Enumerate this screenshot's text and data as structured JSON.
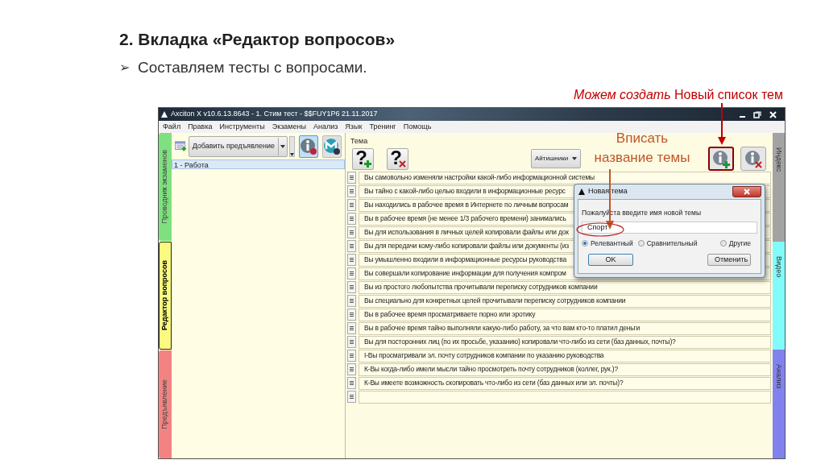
{
  "slide": {
    "heading": "2. Вкладка «Редактор вопросов»",
    "bullet": {
      "marker": "➢",
      "text": "Составляем тесты с вопросами."
    }
  },
  "callouts": [
    {
      "kind": "top",
      "text": "*Можем создать* Новый список тем"
    },
    {
      "kind": "field",
      "text": "Вписать название темы"
    }
  ],
  "window": {
    "title": "Axciton X v10.6.13.8643 - 1. Стим тест - $$FUY1P6 21.11.2017",
    "menu": [
      "Файл",
      "Правка",
      "Инструменты",
      "Экзамены",
      "Анализ",
      "Язык",
      "Тренинг",
      "Помощь"
    ],
    "left_tabs": [
      {
        "label": "Проводник экзаменов",
        "color": "#7fe07f",
        "selected": false
      },
      {
        "label": "Редактор вопросов",
        "color": "#fafa80",
        "selected": true
      },
      {
        "label": "Предъявление",
        "color": "#f38383",
        "selected": false
      }
    ],
    "toolbar": {
      "add_button": "Добавить предъявление",
      "tools": [
        {
          "kind": "info",
          "selected": true
        },
        {
          "kind": "media",
          "selected": false
        }
      ]
    },
    "exams": [
      {
        "label": "1 - Работа",
        "selected": true
      }
    ],
    "topic_label": "Тема",
    "question_buttons": [
      {
        "kind": "add",
        "symbol": "?"
      },
      {
        "kind": "delete",
        "symbol": "?"
      }
    ],
    "topic_dropdown": "Айтишники",
    "topic_buttons": [
      {
        "kind": "add",
        "highlighted": true
      },
      {
        "kind": "delete",
        "highlighted": false
      }
    ],
    "questions": [
      "Вы самовольно изменяли настройки какой-либо информационной системы",
      "Вы тайно с какой-либо целью входили в информационные ресурс",
      "Вы находились в рабочее время в Интернете по личным вопросам",
      "Вы в рабочее время (не менее 1/3 рабочего времени) занимались",
      "Вы для использования в личных целей копировали файлы или док",
      "Вы для передачи кому-либо копировали файлы или документы (из",
      "Вы умышленно входили в информационные ресурсы руководства",
      "Вы совершали копирование информации для получения компром",
      "Вы из простого любопытства прочитывали переписку сотрудников компании",
      "Вы специально для конкретных целей прочитывали переписку сотрудников компании",
      "Вы в рабочее время просматриваете порно или эротику",
      "Вы в рабочее время тайно выполняли какую-либо работу, за что вам кто-то платил деньги",
      "Вы для посторонних лиц (по их просьбе, указанию) копировали что-либо из сети (баз данных, почты)?",
      "I-Вы просматривали эл. почту сотрудников компании по указанию руководства",
      "К-Вы когда-либо имели мысли тайно просмотреть почту сотрудников (коллег, рук.)?",
      "К-Вы имеете возможность скопировать что-либо из сети (баз данных или эл. почты)?"
    ],
    "right_tabs": [
      {
        "label": "Индекс",
        "color": "#a3a3a3"
      },
      {
        "label": "Видео",
        "color": "#80fafa"
      },
      {
        "label": "Анализ",
        "color": "#8282ee"
      }
    ]
  },
  "dialog": {
    "title": "Новая тема",
    "prompt": "Пожалуйста введите имя новой темы",
    "value": "Спорт",
    "options": [
      {
        "label": "Релевантный",
        "selected": true
      },
      {
        "label": "Сравнительный",
        "selected": false
      },
      {
        "label": "Другие",
        "selected": false
      }
    ],
    "buttons": [
      "OK",
      "Отменить"
    ]
  }
}
